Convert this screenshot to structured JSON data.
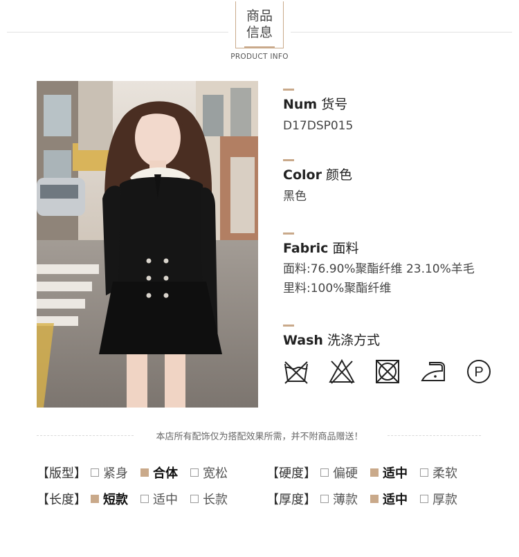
{
  "header": {
    "title_line1": "商品",
    "title_line2": "信息",
    "subtitle": "PRODUCT INFO"
  },
  "info": {
    "num_label_en": "Num",
    "num_label_cn": "货号",
    "num_value": "D17DSP015",
    "color_label_en": "Color",
    "color_label_cn": "颜色",
    "color_value": "黑色",
    "fabric_label_en": "Fabric",
    "fabric_label_cn": "面料",
    "fabric_line1": "面料:76.90%聚酯纤维 23.10%羊毛",
    "fabric_line2": "里料:100%聚酯纤维",
    "wash_label_en": "Wash",
    "wash_label_cn": "洗涤方式"
  },
  "wash_icons": [
    "no-wash-icon",
    "no-bleach-icon",
    "no-tumble-dry-icon",
    "iron-low-icon",
    "dry-clean-p-icon"
  ],
  "notice": "本店所有配饰仅为搭配效果所需，并不附商品赠送！",
  "attributes": {
    "fit_label": "【版型】",
    "fit_options": [
      "紧身",
      "合体",
      "宽松"
    ],
    "hardness_label": "【硬度】",
    "hardness_options": [
      "偏硬",
      "适中",
      "柔软"
    ],
    "length_label": "【长度】",
    "length_options": [
      "短款",
      "适中",
      "长款"
    ],
    "thickness_label": "【厚度】",
    "thickness_options": [
      "薄款",
      "适中",
      "厚款"
    ]
  },
  "colors": {
    "accent": "#c9a98a"
  }
}
